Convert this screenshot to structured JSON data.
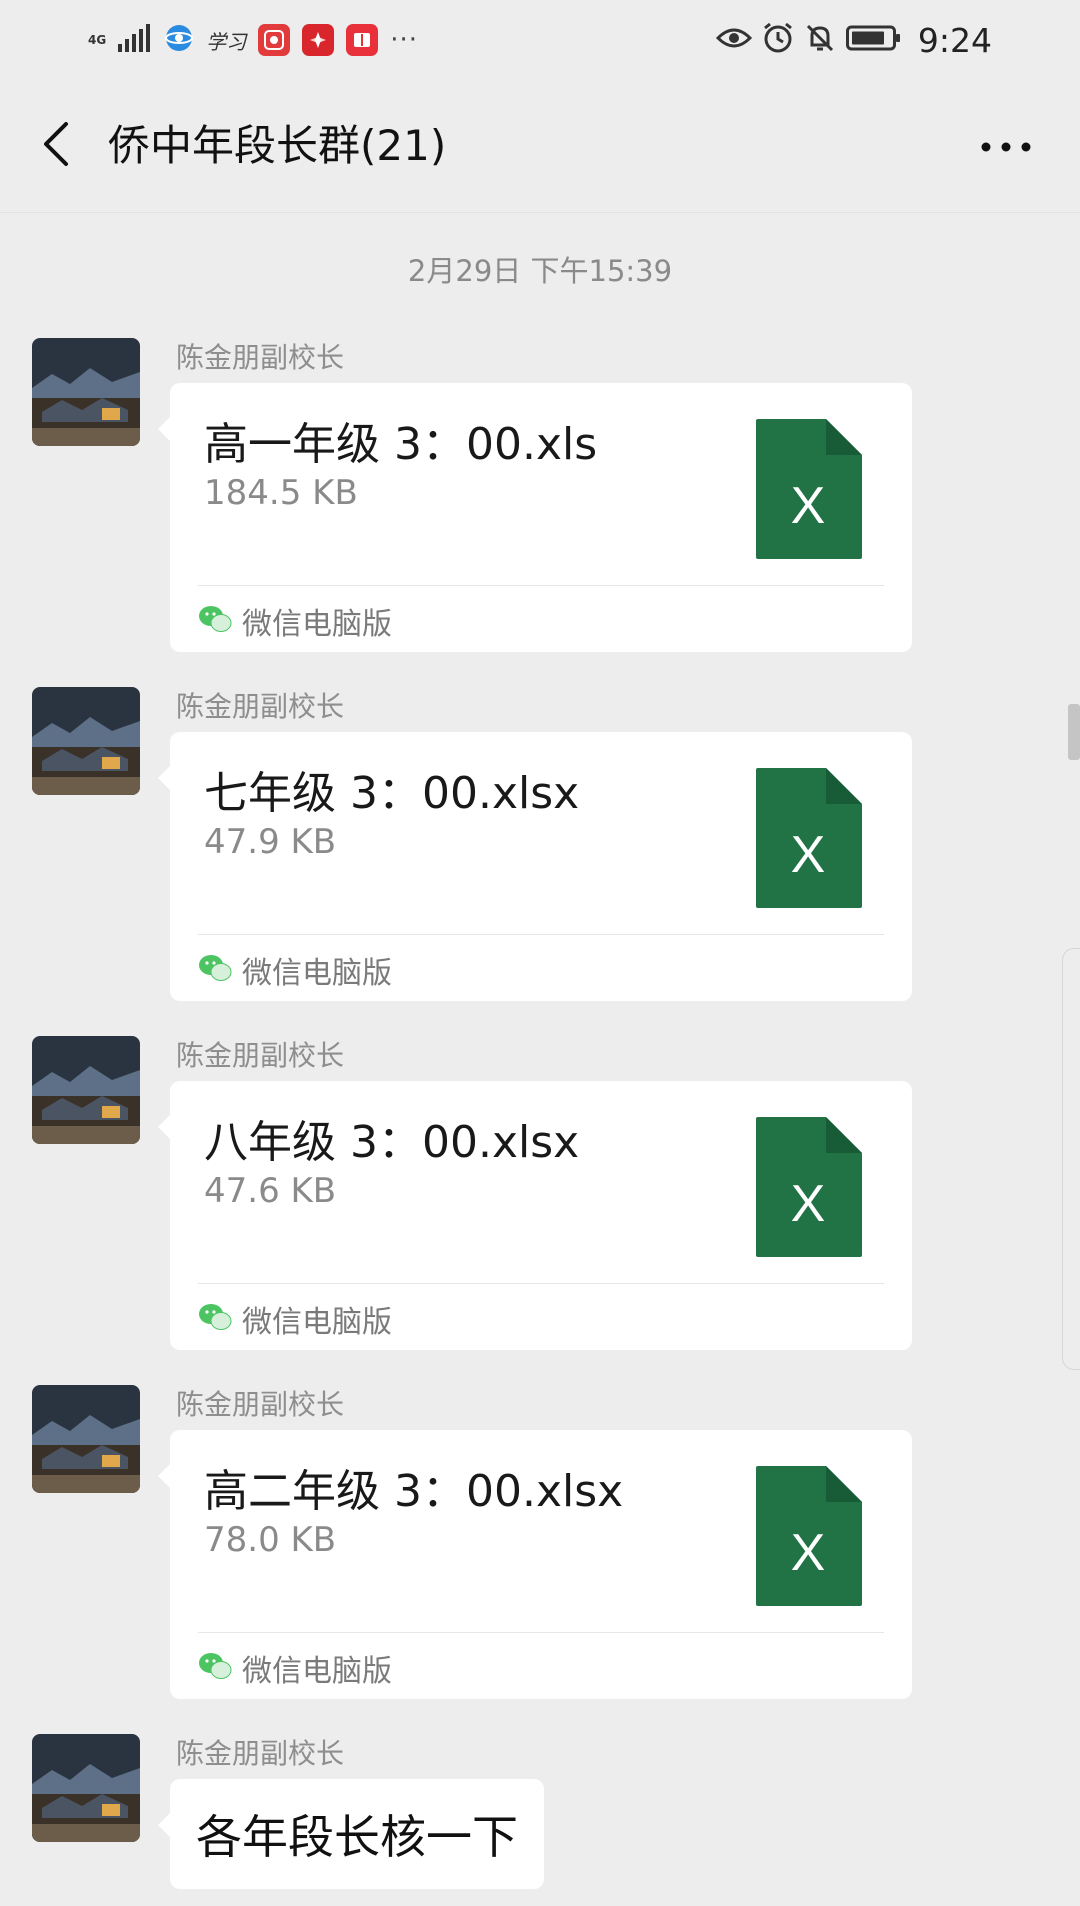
{
  "status_bar": {
    "network": "4G",
    "signal_icon": "signal-bars-icon",
    "app_icons": [
      "browser-icon",
      "xuexi-icon",
      "dianping-icon",
      "huawei-icon",
      "reader-icon"
    ],
    "xuexi_label": "学习",
    "more": "···",
    "right_icons": [
      "eye-icon",
      "alarm-icon",
      "mute-icon",
      "battery-icon"
    ],
    "time": "9:24"
  },
  "nav": {
    "back_icon": "chevron-left-icon",
    "title": "侨中年段长群(21)",
    "more_icon": "more-dots-icon"
  },
  "chat": {
    "timestamp": "2月29日 下午15:39",
    "messages": [
      {
        "sender": "陈金朋副校长",
        "type": "file",
        "file_name": "高一年级 3：00.xls",
        "file_size": "184.5 KB",
        "file_icon_letter": "X",
        "source": "微信电脑版"
      },
      {
        "sender": "陈金朋副校长",
        "type": "file",
        "file_name": "七年级 3：00.xlsx",
        "file_size": "47.9 KB",
        "file_icon_letter": "X",
        "source": "微信电脑版"
      },
      {
        "sender": "陈金朋副校长",
        "type": "file",
        "file_name": "八年级 3：00.xlsx",
        "file_size": "47.6 KB",
        "file_icon_letter": "X",
        "source": "微信电脑版"
      },
      {
        "sender": "陈金朋副校长",
        "type": "file",
        "file_name": "高二年级 3：00.xlsx",
        "file_size": "78.0 KB",
        "file_icon_letter": "X",
        "source": "微信电脑版"
      },
      {
        "sender": "陈金朋副校长",
        "type": "text",
        "text": "各年段长核一下"
      }
    ]
  },
  "colors": {
    "background": "#ededed",
    "bubble": "#ffffff",
    "excel_green": "#217346",
    "excel_fold": "#185c37",
    "wechat_green": "#4cc462"
  }
}
